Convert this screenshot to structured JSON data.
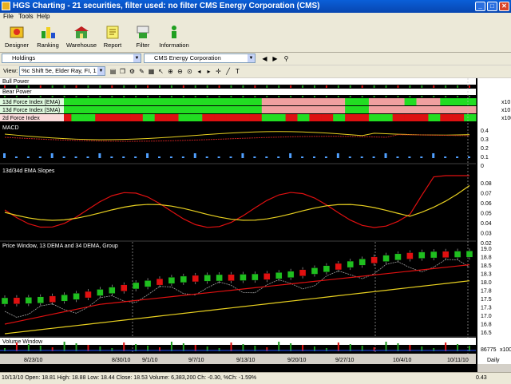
{
  "window": {
    "title": "HGS Charting - 21 securities, filter used: no filter       CMS Energy Corporation (CMS)",
    "controls": [
      "_",
      "□",
      "✕"
    ]
  },
  "menu": [
    "File",
    "Tools",
    "Help"
  ],
  "toolbar": [
    {
      "label": "Designer",
      "icon": "designer-icon"
    },
    {
      "label": "Ranking",
      "icon": "ranking-icon"
    },
    {
      "label": "Warehouse",
      "icon": "warehouse-icon"
    },
    {
      "label": "Report",
      "icon": "report-icon"
    },
    {
      "label": "Filter",
      "icon": "filter-icon"
    },
    {
      "label": "Information",
      "icon": "information-icon"
    }
  ],
  "combos": {
    "holdings": "Holdings",
    "security": "CMS Energy Corporation",
    "view_label": "View:",
    "view": "%c Shift 5e, Elder Ray, FI, 1"
  },
  "panels": {
    "bull_power": "Bull Power",
    "bear_power": "Bear Power",
    "fi13_ema": "13d Force Index (EMA)",
    "fi13_sma": "13d Force Index (SMA)",
    "fi2": "2d Force Index",
    "macd": "MACD",
    "slopes": "13d/34d EMA Slopes",
    "price": "Price Window, 13 DEMA and 34 DEMA, Group",
    "volume": "Volume Window"
  },
  "axis_labels": {
    "fi_suffix_1": "x10",
    "fi_suffix_2": "x10",
    "fi_suffix_3": "x100",
    "macd_ticks": [
      "0.4",
      "0.3",
      "0.2",
      "0.1",
      "0"
    ],
    "slope_ticks": [
      "0.08",
      "0.07",
      "0.06",
      "0.05",
      "0.04",
      "0.03",
      "0.02"
    ],
    "price_ticks": [
      "19.0",
      "18.8",
      "18.5",
      "18.3",
      "18.0",
      "17.8",
      "17.5",
      "17.3",
      "17.0",
      "16.8",
      "16.5"
    ],
    "volume_ticks": [
      "86775",
      "x100"
    ],
    "period": "Daily",
    "corner_value": "0.43"
  },
  "dates": [
    "8/23/10",
    "8/30/10",
    "9/1/10",
    "9/7/10",
    "9/13/10",
    "9/20/10",
    "9/27/10",
    "10/4/10",
    "10/11/10"
  ],
  "status": "10/13/10 Open: 18.81 High: 18.88 Low: 18.44 Close: 18.53 Volume: 6,383,200 Ch: -0.30, %Ch: -1.59%",
  "colors": {
    "up": "#1fbf1f",
    "down": "#e01010",
    "ema13": "#e01010",
    "ema34": "#e8d020",
    "green_bar": "#22dd22",
    "pink_bar": "#f0a0a0",
    "red_bar": "#dd1111"
  }
}
